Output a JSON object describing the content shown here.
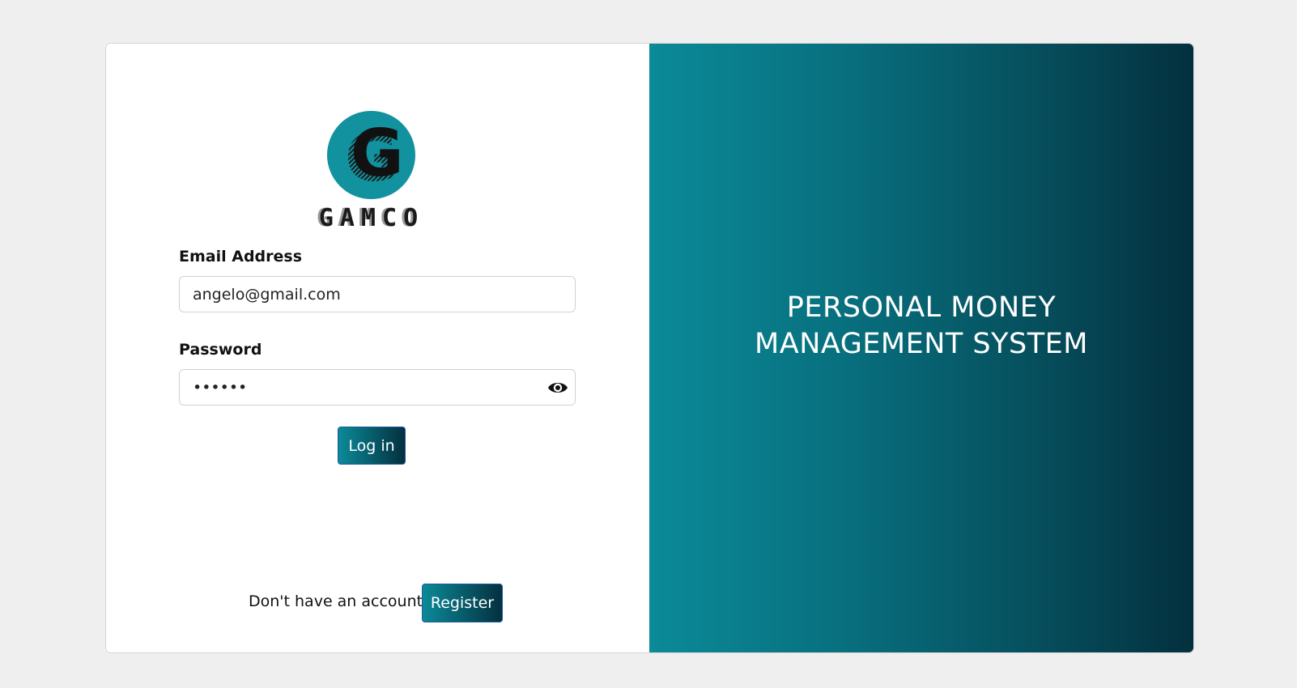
{
  "brand": {
    "logo_letter": "G",
    "name": "GAMCO"
  },
  "form": {
    "email_label": "Email Address",
    "email_value": "angelo@gmail.com",
    "password_label": "Password",
    "password_masked": "••••••",
    "login_label": "Log in",
    "no_account_text": "Don't have an account?",
    "register_label": "Register"
  },
  "hero": {
    "title": "PERSONAL MONEY MANAGEMENT SYSTEM"
  },
  "icons": {
    "password_toggle": "eye-icon"
  },
  "colors": {
    "background": "#efefef",
    "accent_start": "#0b8a98",
    "accent_end": "#04303f",
    "logo_circle": "#11929e"
  }
}
